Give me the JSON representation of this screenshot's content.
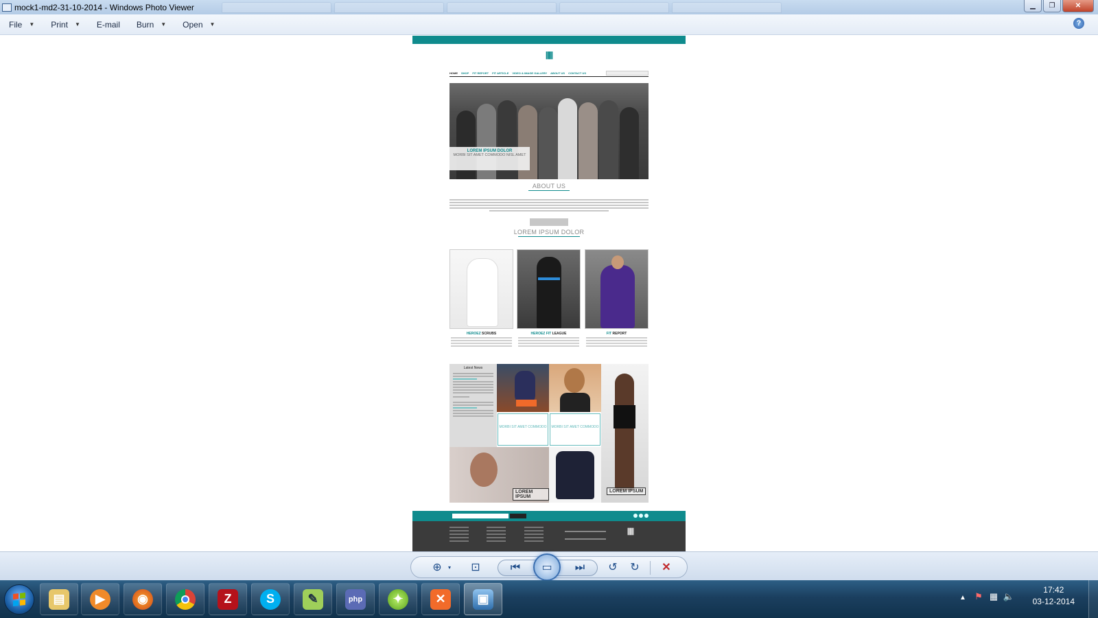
{
  "window": {
    "title": "mock1-md2-31-10-2014 - Windows Photo Viewer",
    "controls": {
      "minimize": "▁",
      "restore": "❐",
      "close": "✕"
    }
  },
  "menu": {
    "items": [
      {
        "label": "File",
        "has_dropdown": true
      },
      {
        "label": "Print",
        "has_dropdown": true
      },
      {
        "label": "E-mail",
        "has_dropdown": false
      },
      {
        "label": "Burn",
        "has_dropdown": true
      },
      {
        "label": "Open",
        "has_dropdown": true
      }
    ],
    "help_icon": "?"
  },
  "mockup": {
    "nav": [
      "HOME",
      "SHOP",
      "FIT REPORT",
      "FIT ARTICLE",
      "VIDEO & IMAGE GALLERY",
      "ABOUT US",
      "CONTACT US"
    ],
    "hero": {
      "heading": "LOREM IPSUM DOLOR",
      "subheading": "MORBI SIT AMET COMMODO NISL AMET"
    },
    "about_title": "ABOUT US",
    "section_title": "LOREM IPSUM DOLOR",
    "cards": [
      {
        "accent": "HEROEZ",
        "rest": " SCRUBS"
      },
      {
        "accent": "HEROEZ FIT",
        "rest": " LEAGUE"
      },
      {
        "accent": "FIT",
        "rest": " REPORT"
      }
    ],
    "news_title": "Latest News",
    "promos": [
      "MORBI SIT AMET COMMODO",
      "MORBI SIT AMET COMMODO"
    ],
    "badges": [
      "LOREM IPSUM",
      "LOREM IPSUM"
    ],
    "brand_color": "#0f8b8d"
  },
  "viewer_controls": {
    "icons": [
      "zoom-icon",
      "actual-size-icon",
      "previous-icon",
      "slideshow-icon",
      "next-icon",
      "rotate-left-icon",
      "rotate-right-icon",
      "delete-icon"
    ]
  },
  "taskbar": {
    "apps": [
      "file-explorer-icon",
      "media-player-icon",
      "firefox-icon",
      "chrome-icon",
      "filezilla-icon",
      "skype-icon",
      "notepad-plus-icon",
      "php-designer-icon",
      "network-app-icon",
      "xampp-icon",
      "photo-viewer-icon"
    ],
    "clock": {
      "time": "17:42",
      "date": "03-12-2014"
    }
  }
}
